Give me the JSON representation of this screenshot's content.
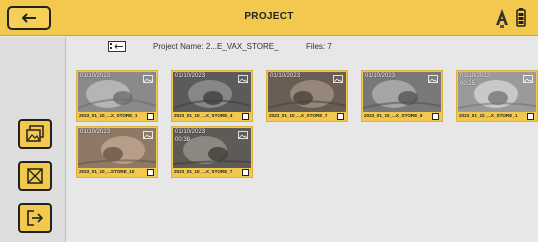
{
  "header": {
    "title": "PROJECT",
    "accent_color": "#f2c94c",
    "back_icon": "arrow-left-icon",
    "status_icons": [
      "tool-a-icon",
      "battery-icon"
    ]
  },
  "sidebar": {
    "items": [
      {
        "icon": "gallery-icon",
        "name": "gallery-button"
      },
      {
        "icon": "select-box-icon",
        "name": "select-button"
      },
      {
        "icon": "exit-icon",
        "name": "exit-button"
      }
    ]
  },
  "project": {
    "name_label": "Project Name: 2...E_VAX_STORE_",
    "files_label": "Files: 7"
  },
  "files": [
    {
      "date": "01/10/2023",
      "duration": "",
      "type": "photo",
      "filename": "2023_01_10_...X_STORE_1"
    },
    {
      "date": "01/10/2023",
      "duration": "",
      "type": "photo",
      "filename": "2023_01_10_...X_STORE_4"
    },
    {
      "date": "01/10/2023",
      "duration": "",
      "type": "photo",
      "filename": "2023_01_10_...X_STORE_7"
    },
    {
      "date": "01/10/2023",
      "duration": "",
      "type": "photo",
      "filename": "2023_01_10_...X_STORE_6"
    },
    {
      "date": "01/10/2023",
      "duration": "00:25",
      "type": "video",
      "filename": "2023_01_10_...X_STORE_1"
    },
    {
      "date": "01/10/2023",
      "duration": "",
      "type": "photo",
      "filename": "2023_01_10_...STORE_10"
    },
    {
      "date": "01/10/2023",
      "duration": "00:38",
      "type": "video",
      "filename": "2023_01_10_...X_STORE_7"
    }
  ]
}
